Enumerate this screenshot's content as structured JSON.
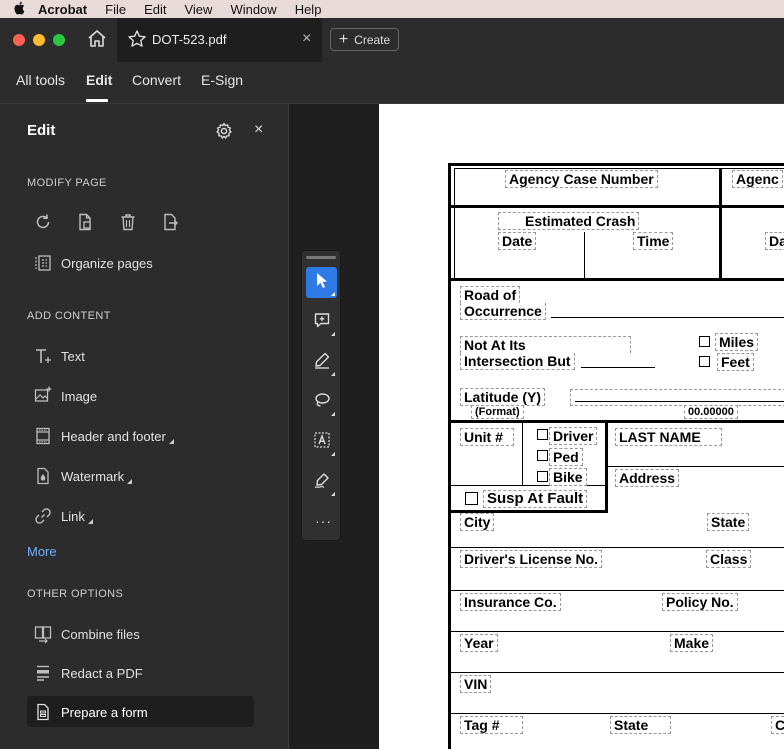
{
  "menubar": {
    "app": "Acrobat",
    "items": [
      "File",
      "Edit",
      "View",
      "Window",
      "Help"
    ]
  },
  "tab": {
    "title": "DOT-523.pdf",
    "close": "×"
  },
  "create_button": {
    "label": "Create"
  },
  "toolbar": {
    "tabs": [
      "All tools",
      "Edit",
      "Convert",
      "E-Sign"
    ]
  },
  "panel": {
    "title": "Edit",
    "close": "×",
    "modify_heading": "MODIFY PAGE",
    "organize": "Organize pages",
    "add_heading": "ADD CONTENT",
    "add_items": [
      "Text",
      "Image",
      "Header and footer",
      "Watermark",
      "Link"
    ],
    "more": "More",
    "other_heading": "OTHER OPTIONS",
    "other_items": [
      "Combine files",
      "Redact a PDF",
      "Prepare a form"
    ]
  },
  "vertical_tools": {
    "more": "···"
  },
  "form": {
    "agency_case": "Agency Case Number",
    "agency_cut": "Agenc",
    "estimated_crash": "Estimated Crash",
    "date": "Date",
    "time": "Time",
    "da_cut": "Da",
    "road_line1": "Road of",
    "road_line2": "Occurrence",
    "not_at_line1": "Not At Its",
    "not_at_line2": "Intersection But",
    "miles": "Miles",
    "feet": "Feet",
    "latitude": "Latitude  (Y)",
    "format": "(Format)",
    "format_value": "00.00000",
    "unit": "Unit #",
    "driver": "Driver",
    "ped": "Ped",
    "bike": "Bike",
    "susp": "Susp At Fault",
    "last_name": "LAST NAME",
    "address": "Address",
    "city": "City",
    "state": "State",
    "dl": "Driver's License No.",
    "class": "Class",
    "insurance": "Insurance Co.",
    "policy": "Policy No.",
    "year": "Year",
    "make": "Make",
    "vin": "VIN",
    "tag": "Tag #",
    "tag_state": "State",
    "c_cut": "C"
  }
}
